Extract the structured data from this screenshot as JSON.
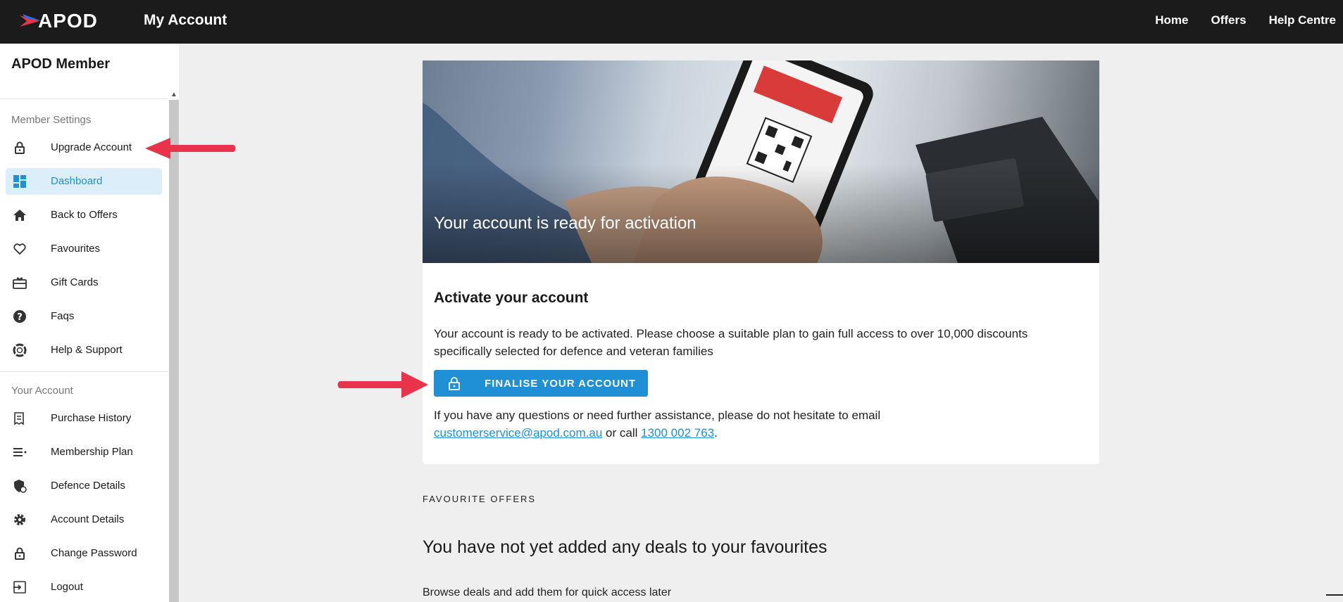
{
  "header": {
    "logo_text": "APOD",
    "title": "My Account",
    "nav": [
      {
        "label": "Home"
      },
      {
        "label": "Offers"
      },
      {
        "label": "Help Centre"
      }
    ]
  },
  "sidebar": {
    "title": "APOD Member",
    "sections": [
      {
        "label": "Member Settings",
        "items": [
          {
            "label": "Upgrade Account",
            "icon": "lock-icon"
          },
          {
            "label": "Dashboard",
            "icon": "dashboard-icon",
            "active": true
          },
          {
            "label": "Back to Offers",
            "icon": "home-icon"
          },
          {
            "label": "Favourites",
            "icon": "heart-icon"
          },
          {
            "label": "Gift Cards",
            "icon": "gift-card-icon"
          },
          {
            "label": "Faqs",
            "icon": "help-circle-icon"
          },
          {
            "label": "Help & Support",
            "icon": "lifebuoy-icon"
          }
        ]
      },
      {
        "label": "Your Account",
        "items": [
          {
            "label": "Purchase History",
            "icon": "receipt-icon"
          },
          {
            "label": "Membership Plan",
            "icon": "list-icon"
          },
          {
            "label": "Defence Details",
            "icon": "shield-icon"
          },
          {
            "label": "Account Details",
            "icon": "gear-icon"
          },
          {
            "label": "Change Password",
            "icon": "lock-icon"
          },
          {
            "label": "Logout",
            "icon": "logout-icon"
          }
        ]
      }
    ]
  },
  "main": {
    "hero_title": "Your account is ready for activation",
    "card": {
      "heading": "Activate your account",
      "body": "Your account is ready to be activated. Please choose a suitable plan to gain full access to over 10,000 discounts specifically selected for defence and veteran families",
      "button_label": "FINALISE YOUR ACCOUNT",
      "help_prefix": "If you have any questions or need further assistance, please do not hesitate to email",
      "email": "customerservice@apod.com.au",
      "help_mid": "or call",
      "phone": "1300 002 763",
      "help_suffix": "."
    },
    "favourites": {
      "label": "FAVOURITE OFFERS",
      "heading": "You have not yet added any deals to your favourites",
      "subtext": "Browse deals and add them for quick access later"
    }
  },
  "colors": {
    "accent": "#1f8fd6",
    "annotation_arrow": "#e8334a",
    "topbar": "#1b1b1b"
  }
}
